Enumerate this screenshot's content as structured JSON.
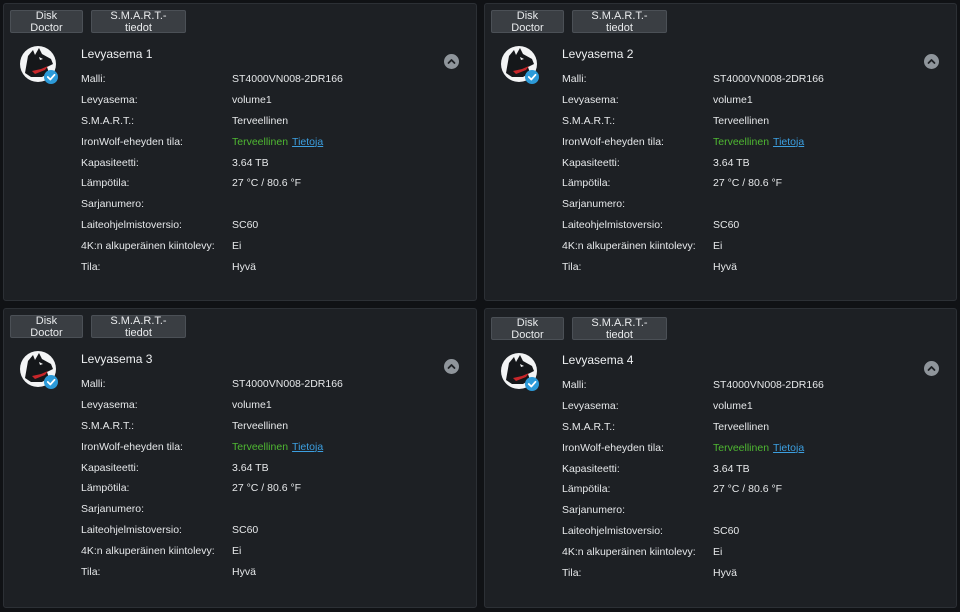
{
  "labels": {
    "model": "Malli:",
    "volume": "Levyasema:",
    "smart": "S.M.A.R.T.:",
    "ironwolf": "IronWolf-eheyden tila:",
    "capacity": "Kapasiteetti:",
    "temperature": "Lämpötila:",
    "serial": "Sarjanumero:",
    "firmware": "Laiteohjelmistoversio:",
    "native4k": "4K:n alkuperäinen kiintolevy:",
    "status": "Tila:"
  },
  "colors": {
    "healthy_green": "#4fb832",
    "link_blue": "#3c9fe0",
    "panel_bg": "#1d2024",
    "page_bg": "#101215"
  },
  "drives": [
    {
      "disk_doctor_label": "Disk Doctor",
      "smart_info_label": "S.M.A.R.T.-tiedot",
      "title": "Levyasema 1",
      "model": "ST4000VN008-2DR166",
      "volume": "volume1",
      "smart": "Terveellinen",
      "ironwolf": "Terveellinen",
      "ironwolf_link": "Tietoja",
      "capacity": "3.64 TB",
      "temperature": "27 °C / 80.6 °F",
      "serial": "",
      "firmware": "SC60",
      "native4k": "Ei",
      "status": "Hyvä",
      "icon": "seagate-ironwolf-logo",
      "badge_icon": "check-badge-icon",
      "collapse_icon": "chevron-up-icon"
    },
    {
      "disk_doctor_label": "Disk Doctor",
      "smart_info_label": "S.M.A.R.T.-tiedot",
      "title": "Levyasema 2",
      "model": "ST4000VN008-2DR166",
      "volume": "volume1",
      "smart": "Terveellinen",
      "ironwolf": "Terveellinen",
      "ironwolf_link": "Tietoja",
      "capacity": "3.64 TB",
      "temperature": "27 °C / 80.6 °F",
      "serial": "",
      "firmware": "SC60",
      "native4k": "Ei",
      "status": "Hyvä",
      "icon": "seagate-ironwolf-logo",
      "badge_icon": "check-badge-icon",
      "collapse_icon": "chevron-up-icon"
    },
    {
      "disk_doctor_label": "Disk Doctor",
      "smart_info_label": "S.M.A.R.T.-tiedot",
      "title": "Levyasema 3",
      "model": "ST4000VN008-2DR166",
      "volume": "volume1",
      "smart": "Terveellinen",
      "ironwolf": "Terveellinen",
      "ironwolf_link": "Tietoja",
      "capacity": "3.64 TB",
      "temperature": "27 °C / 80.6 °F",
      "serial": "",
      "firmware": "SC60",
      "native4k": "Ei",
      "status": "Hyvä",
      "icon": "seagate-ironwolf-logo",
      "badge_icon": "check-badge-icon",
      "collapse_icon": "chevron-up-icon"
    },
    {
      "disk_doctor_label": "Disk Doctor",
      "smart_info_label": "S.M.A.R.T.-tiedot",
      "title": "Levyasema 4",
      "model": "ST4000VN008-2DR166",
      "volume": "volume1",
      "smart": "Terveellinen",
      "ironwolf": "Terveellinen",
      "ironwolf_link": "Tietoja",
      "capacity": "3.64 TB",
      "temperature": "27 °C / 80.6 °F",
      "serial": "",
      "firmware": "SC60",
      "native4k": "Ei",
      "status": "Hyvä",
      "icon": "seagate-ironwolf-logo",
      "badge_icon": "check-badge-icon",
      "collapse_icon": "chevron-up-icon"
    }
  ]
}
